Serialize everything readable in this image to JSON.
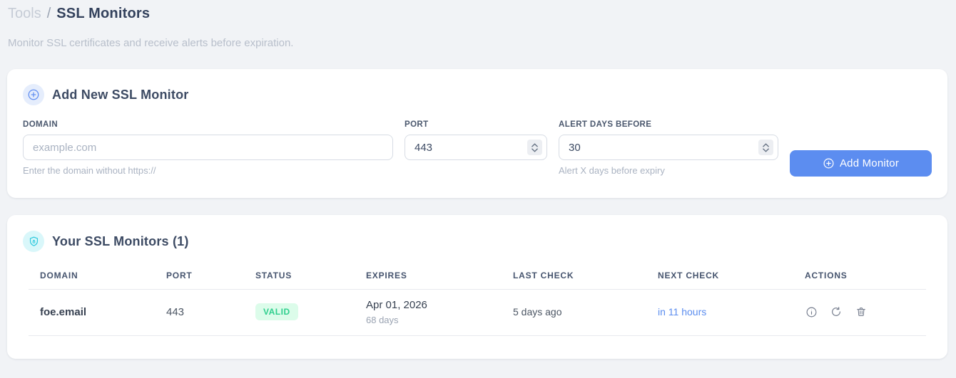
{
  "breadcrumb": {
    "section": "Tools",
    "separator": "/",
    "current": "SSL Monitors"
  },
  "subtitle": "Monitor SSL certificates and receive alerts before expiration.",
  "add_card": {
    "title": "Add New SSL Monitor",
    "domain_field": {
      "label": "DOMAIN",
      "placeholder": "example.com",
      "value": "",
      "helper": "Enter the domain without https://"
    },
    "port_field": {
      "label": "PORT",
      "value": "443"
    },
    "alert_field": {
      "label": "ALERT DAYS BEFORE",
      "value": "30",
      "helper": "Alert X days before expiry"
    },
    "submit_label": "Add Monitor"
  },
  "monitors_card": {
    "title": "Your SSL Monitors (1)",
    "table": {
      "headers": [
        "DOMAIN",
        "PORT",
        "STATUS",
        "EXPIRES",
        "LAST CHECK",
        "NEXT CHECK",
        "ACTIONS"
      ],
      "rows": [
        {
          "domain": "foe.email",
          "port": "443",
          "status": "VALID",
          "expires_date": "Apr 01, 2026",
          "expires_remaining": "68 days",
          "last_check": "5 days ago",
          "next_check": "in 11 hours"
        }
      ]
    }
  },
  "icons": {
    "add_card_badge": "plus-circle",
    "monitors_card_badge": "shield-lock",
    "submit_button": "plus-circle",
    "row_actions": [
      "info-circle",
      "refresh",
      "trash"
    ]
  },
  "colors": {
    "page_bg": "#f1f3f6",
    "card_bg": "#ffffff",
    "accent_blue": "#5c8df0",
    "next_check_link": "#5b8def",
    "badge_valid_text": "#2fcf8e",
    "badge_valid_bg": "#dcfcea",
    "icon_cyan": "#2fc9dd",
    "icon_cyan_bg": "#d9f7fa",
    "icon_blue": "#628ff1",
    "icon_blue_bg": "#e5edfc"
  }
}
